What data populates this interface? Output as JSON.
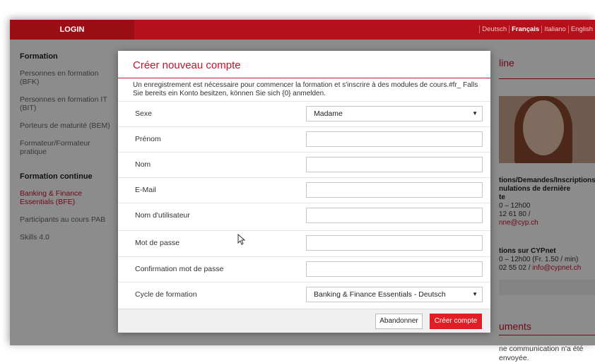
{
  "topbar": {
    "login_label": "LOGIN",
    "languages": [
      "Deutsch",
      "Français",
      "Italiano",
      "English"
    ],
    "active_language": "Français"
  },
  "sidebar": {
    "sections": [
      {
        "heading": "Formation",
        "items": [
          {
            "label": "Personnes en formation (BFK)",
            "active": false
          },
          {
            "label": "Personnes en formation IT (BIT)",
            "active": false
          },
          {
            "label": "Porteurs de maturité (BEM)",
            "active": false
          },
          {
            "label": "Formateur/Formateur pratique",
            "active": false
          }
        ]
      },
      {
        "heading": "Formation continue",
        "items": [
          {
            "label": "Banking & Finance Essentials (BFE)",
            "active": true
          },
          {
            "label": "Participants au cours PAB",
            "active": false
          },
          {
            "label": "Skills 4.0",
            "active": false
          }
        ]
      }
    ]
  },
  "right_panel": {
    "title_fragment": "line",
    "contact_heading_1": "tions/Demandes/Inscriptions",
    "contact_heading_2": "nulations de dernière",
    "contact_heading_3": "te",
    "hours_1": "0 – 12h00",
    "phone_1": "12 61 80 /",
    "email_1": "nne@cyp.ch",
    "cypnet_heading": "tions sur CYPnet",
    "hours_2": "0 – 12h00 (Fr. 1.50 / min)",
    "phone_2": "02 55 02 /",
    "email_2": "info@cypnet.ch",
    "docs_title": "uments",
    "docs_text_1": "ne communication n'a été",
    "docs_text_2": "envoyée."
  },
  "modal": {
    "title": "Créer nouveau compte",
    "info": "Un enregistrement est nécessaire pour commencer la formation et s'inscrire à des modules de cours.#fr_ Falls Sie bereits ein Konto besitzen, können Sie sich {0} anmelden.",
    "fields": {
      "sexe": {
        "label": "Sexe",
        "value": "Madame"
      },
      "prenom": {
        "label": "Prénom",
        "value": ""
      },
      "nom": {
        "label": "Nom",
        "value": ""
      },
      "email": {
        "label": "E-Mail",
        "value": ""
      },
      "username": {
        "label": "Nom d'utilisateur",
        "value": ""
      },
      "password": {
        "label": "Mot de passe",
        "value": ""
      },
      "password_confirm": {
        "label": "Confirmation mot de passe",
        "value": ""
      },
      "cycle": {
        "label": "Cycle de formation",
        "value": "Banking & Finance Essentials - Deutsch"
      }
    },
    "cancel_label": "Abandonner",
    "submit_label": "Créer compte"
  },
  "colors": {
    "brand_red": "#c8102e",
    "topbar": "#b5111a",
    "button_red": "#e01e26"
  },
  "icons": {
    "caret": "caret-down-icon",
    "cursor": "mouse-pointer-icon"
  }
}
